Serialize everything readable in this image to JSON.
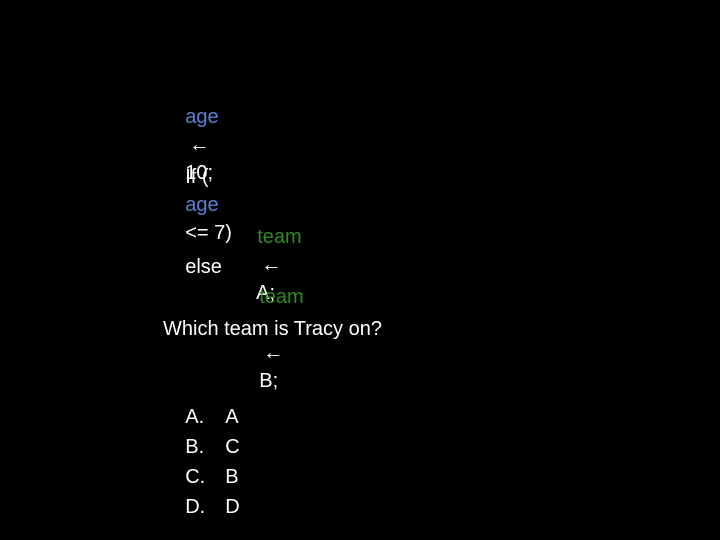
{
  "colors": {
    "background": "#000000",
    "text": "#ffffff",
    "variable_age": "#5b7fd6",
    "variable_team": "#2f8a22"
  },
  "code": {
    "assign_age": {
      "var": "age",
      "arrow": "←",
      "value": "10;"
    },
    "if_line": {
      "prefix": "If (",
      "var": "age",
      "suffix": "<= 7)"
    },
    "then_assign": {
      "var": "team",
      "arrow": "←",
      "value": "A;"
    },
    "else_keyword": "else",
    "else_assign": {
      "var": "team",
      "arrow": "←",
      "value": "B;"
    }
  },
  "question": {
    "text": "Which team is Tracy on?",
    "options": [
      {
        "letter": "A.",
        "value": "A"
      },
      {
        "letter": "B.",
        "value": "C"
      },
      {
        "letter": "C.",
        "value": "B"
      },
      {
        "letter": "D.",
        "value": "D"
      }
    ]
  }
}
